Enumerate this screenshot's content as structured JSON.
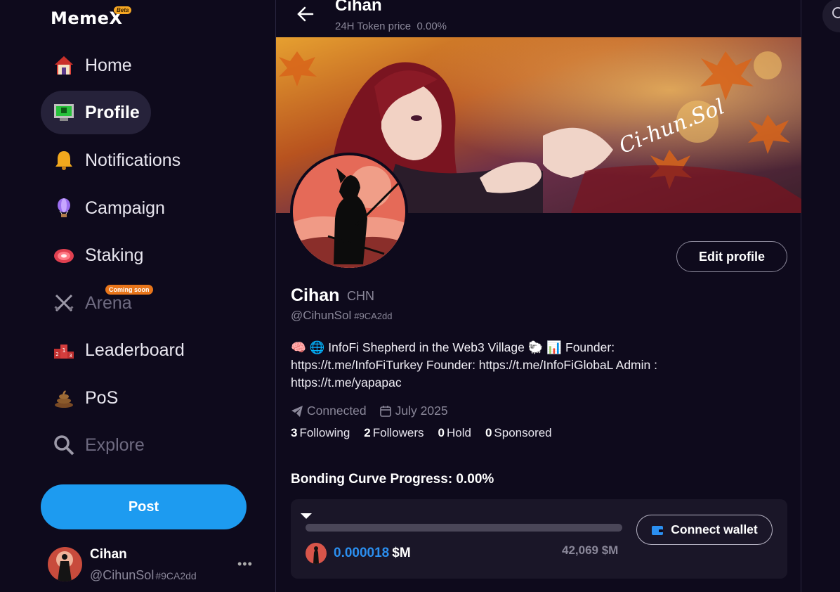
{
  "sidebar": {
    "logo": "MemeX",
    "logo_badge": "Beta",
    "nav": [
      {
        "label": "Home",
        "icon": "house-icon"
      },
      {
        "label": "Profile",
        "icon": "pixel-monitor-icon",
        "active": true
      },
      {
        "label": "Notifications",
        "icon": "bell-icon"
      },
      {
        "label": "Campaign",
        "icon": "balloon-icon"
      },
      {
        "label": "Staking",
        "icon": "meat-icon"
      },
      {
        "label": "Arena",
        "icon": "crossed-swords-icon",
        "disabled": true,
        "badge": "Coming soon"
      },
      {
        "label": "Leaderboard",
        "icon": "podium-icon"
      },
      {
        "label": "PoS",
        "icon": "poop-icon"
      },
      {
        "label": "Explore",
        "icon": "magnifier-icon",
        "disabled": true
      }
    ],
    "post_label": "Post",
    "user": {
      "name": "Cihan",
      "handle": "@CihunSol",
      "hash": "#9CA2dd",
      "more": "•••"
    }
  },
  "header": {
    "title": "Cihan",
    "subtitle_label": "24H Token price",
    "subtitle_value": "0.00%"
  },
  "banner": {
    "watermark": "Ci-hun.Sol"
  },
  "profile": {
    "name": "Cihan",
    "ticker": "CHN",
    "handle": "@CihunSol",
    "hash": "#9CA2dd",
    "edit_label": "Edit profile",
    "bio": "🧠 🌐 InfoFi Shepherd in the Web3 Village 🐑 📊 Founder: https://t.me/InfoFiTurkey Founder: https://t.me/InfoFiGlobaL Admin : https://t.me/yapapac",
    "connected": "Connected",
    "joined": "July 2025",
    "stats": {
      "following_count": "3",
      "following_label": "Following",
      "followers_count": "2",
      "followers_label": "Followers",
      "hold_count": "0",
      "hold_label": "Hold",
      "sponsored_count": "0",
      "sponsored_label": "Sponsored"
    }
  },
  "bonding": {
    "title": "Bonding Curve Progress: 0.00%",
    "progress": 0.0,
    "market_cap": "0.000018",
    "market_cap_unit": "$M",
    "target": "42,069 $M",
    "connect_label": "Connect wallet"
  },
  "colors": {
    "accent": "#1d9bf0",
    "background": "#0e0a1c",
    "card": "#1a1628",
    "muted": "#8a8799"
  }
}
